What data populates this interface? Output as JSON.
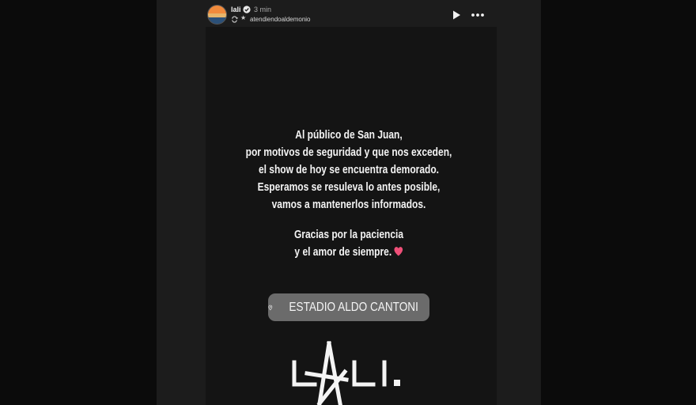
{
  "header": {
    "username": "lali",
    "time_ago": "3 min",
    "source_account": "atendiendoaldemonio",
    "icons": {
      "verified": "verified-badge-icon",
      "repost": "repost-icon",
      "star": "star-icon",
      "play": "play-icon",
      "more": "more-options-icon"
    }
  },
  "story": {
    "message_lines": [
      "Al público de San Juan,",
      "por motivos de seguridad y que nos exceden,",
      "el show de hoy se encuentra demorado.",
      "Esperamos se resuleva lo antes posible,",
      "vamos a mantenerlos informados."
    ],
    "closing_lines": [
      "Gracias por la paciencia",
      "y el amor de siempre."
    ],
    "location": "ESTADIO ALDO CANTONI",
    "logo_text": "LALI."
  },
  "colors": {
    "background": "#0b0b0b",
    "frame": "#1c1c1c",
    "story_bg": "#141414",
    "text": "#f4f4f4",
    "heart": "#ef4f78",
    "sticker": "#6b6b6b"
  }
}
